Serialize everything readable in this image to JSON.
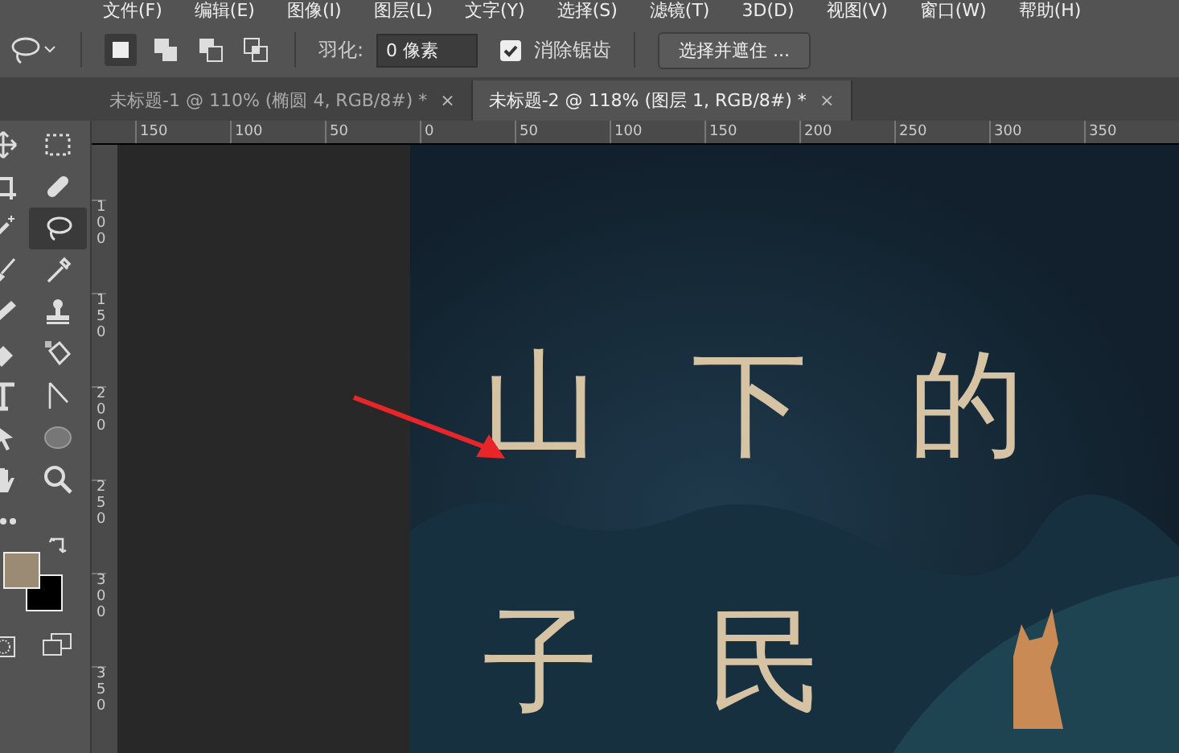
{
  "menu": [
    "文件(F)",
    "编辑(E)",
    "图像(I)",
    "图层(L)",
    "文字(Y)",
    "选择(S)",
    "滤镜(T)",
    "3D(D)",
    "视图(V)",
    "窗口(W)",
    "帮助(H)"
  ],
  "options_bar": {
    "modes": [
      {
        "kind": "new",
        "selected": true
      },
      {
        "kind": "add",
        "selected": false
      },
      {
        "kind": "subtract",
        "selected": false
      },
      {
        "kind": "intersect",
        "selected": false
      }
    ],
    "feather_label": "羽化:",
    "feather_value": "0 像素",
    "anti_alias": {
      "label": "消除锯齿",
      "checked": true
    },
    "refine_button": "选择并遮住 ..."
  },
  "tabs": [
    {
      "title": "未标题-1 @ 110% (椭圆 4, RGB/8#) *",
      "close": "×",
      "selected": false
    },
    {
      "title": "未标题-2 @ 118% (图层 1, RGB/8#) *",
      "close": "×",
      "selected": true
    }
  ],
  "ruler_h": [
    "150",
    "100",
    "50",
    "0",
    "50",
    "100",
    "150",
    "200",
    "250",
    "300",
    "350"
  ],
  "ruler_v": [
    "100",
    "150",
    "200",
    "250",
    "300",
    "350"
  ],
  "tools": [
    {
      "kind": "move",
      "selected": false
    },
    {
      "kind": "marquee",
      "selected": false
    },
    {
      "kind": "crop",
      "selected": false
    },
    {
      "kind": "bandage",
      "selected": false
    },
    {
      "kind": "wand",
      "selected": false
    },
    {
      "kind": "lasso",
      "selected": true
    },
    {
      "kind": "brush",
      "selected": false
    },
    {
      "kind": "eyedropper",
      "selected": false
    },
    {
      "kind": "pencil",
      "selected": false
    },
    {
      "kind": "stamp",
      "selected": false
    },
    {
      "kind": "eraser",
      "selected": false
    },
    {
      "kind": "bucket",
      "selected": false
    },
    {
      "kind": "type",
      "selected": false
    },
    {
      "kind": "path",
      "selected": false
    },
    {
      "kind": "pointer",
      "selected": false
    },
    {
      "kind": "ellipse",
      "selected": false
    },
    {
      "kind": "hand",
      "selected": false
    },
    {
      "kind": "zoom",
      "selected": false
    },
    {
      "kind": "more",
      "selected": false
    }
  ],
  "canvas_rows": [
    [
      "山",
      "下",
      "的"
    ],
    [
      "子",
      "民"
    ]
  ]
}
